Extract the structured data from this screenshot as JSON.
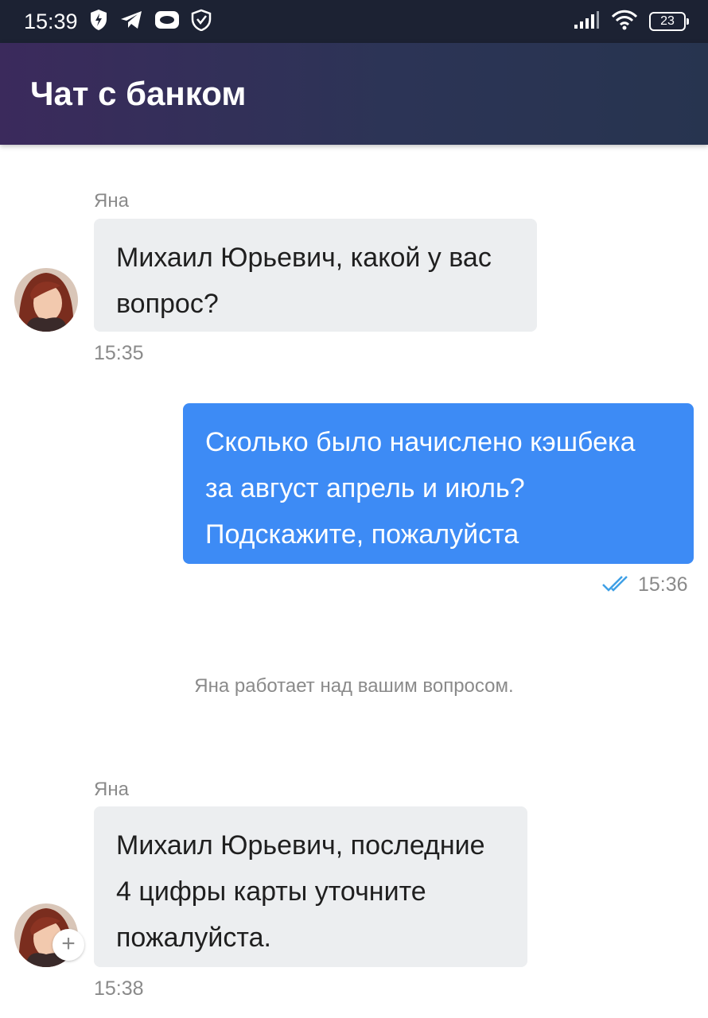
{
  "status_bar": {
    "time": "15:39",
    "battery": "23",
    "icons_left": [
      "shield-bolt-icon",
      "telegram-icon",
      "cloud-icon",
      "vpn-shield-icon"
    ],
    "icons_right": [
      "signal-icon",
      "wifi-icon",
      "battery-icon"
    ]
  },
  "header": {
    "title": "Чат с банком"
  },
  "messages": [
    {
      "sender": "Яна",
      "text_lines": [
        "Михаил Юрьевич, какой у вас",
        "вопрос?"
      ],
      "time": "15:35"
    },
    {
      "text_lines": [
        "Сколько было начислено кэшбека",
        "за август апрель и июль?",
        "Подскажите, пожалуйста"
      ],
      "time": "15:36",
      "status_icon": "double-check-icon"
    },
    {
      "system": "Яна работает над вашим вопросом."
    },
    {
      "sender": "Яна",
      "text_lines": [
        "Михаил Юрьевич, последние",
        "4 цифры карты уточните",
        "пожалуйста."
      ],
      "time": "15:38"
    }
  ],
  "colors": {
    "status_bar": "#1c2233",
    "header_from": "#3b2a5c",
    "header_to": "#27344f",
    "outgoing_bubble": "#3d8bf5",
    "incoming_bubble": "#eceef0",
    "read_check": "#3fa0e6"
  }
}
